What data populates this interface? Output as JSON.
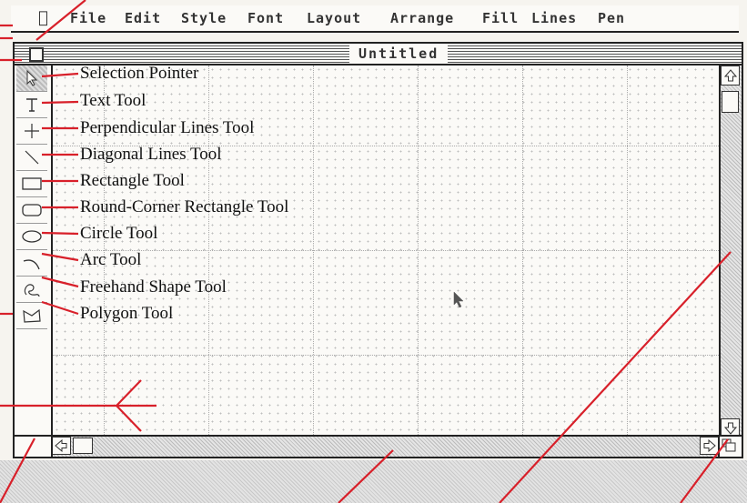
{
  "menubar": {
    "apple_icon": "apple-icon",
    "items": [
      "File",
      "Edit",
      "Style",
      "Font",
      "Layout",
      "Arrange",
      "Fill",
      "Lines",
      "Pen"
    ]
  },
  "window": {
    "title": "Untitled"
  },
  "tools": [
    {
      "icon": "pointer-icon",
      "label": "Selection Pointer"
    },
    {
      "icon": "text-t-icon",
      "label": "Text Tool"
    },
    {
      "icon": "plus-icon",
      "label": "Perpendicular Lines Tool"
    },
    {
      "icon": "diagonal-line-icon",
      "label": "Diagonal Lines Tool"
    },
    {
      "icon": "rectangle-icon",
      "label": "Rectangle Tool"
    },
    {
      "icon": "round-rectangle-icon",
      "label": "Round-Corner Rectangle Tool"
    },
    {
      "icon": "ellipse-icon",
      "label": "Circle Tool"
    },
    {
      "icon": "arc-icon",
      "label": "Arc Tool"
    },
    {
      "icon": "freehand-icon",
      "label": "Freehand Shape Tool"
    },
    {
      "icon": "polygon-icon",
      "label": "Polygon Tool"
    }
  ],
  "colors": {
    "annotation": "#d8202a",
    "ink": "#222222"
  }
}
